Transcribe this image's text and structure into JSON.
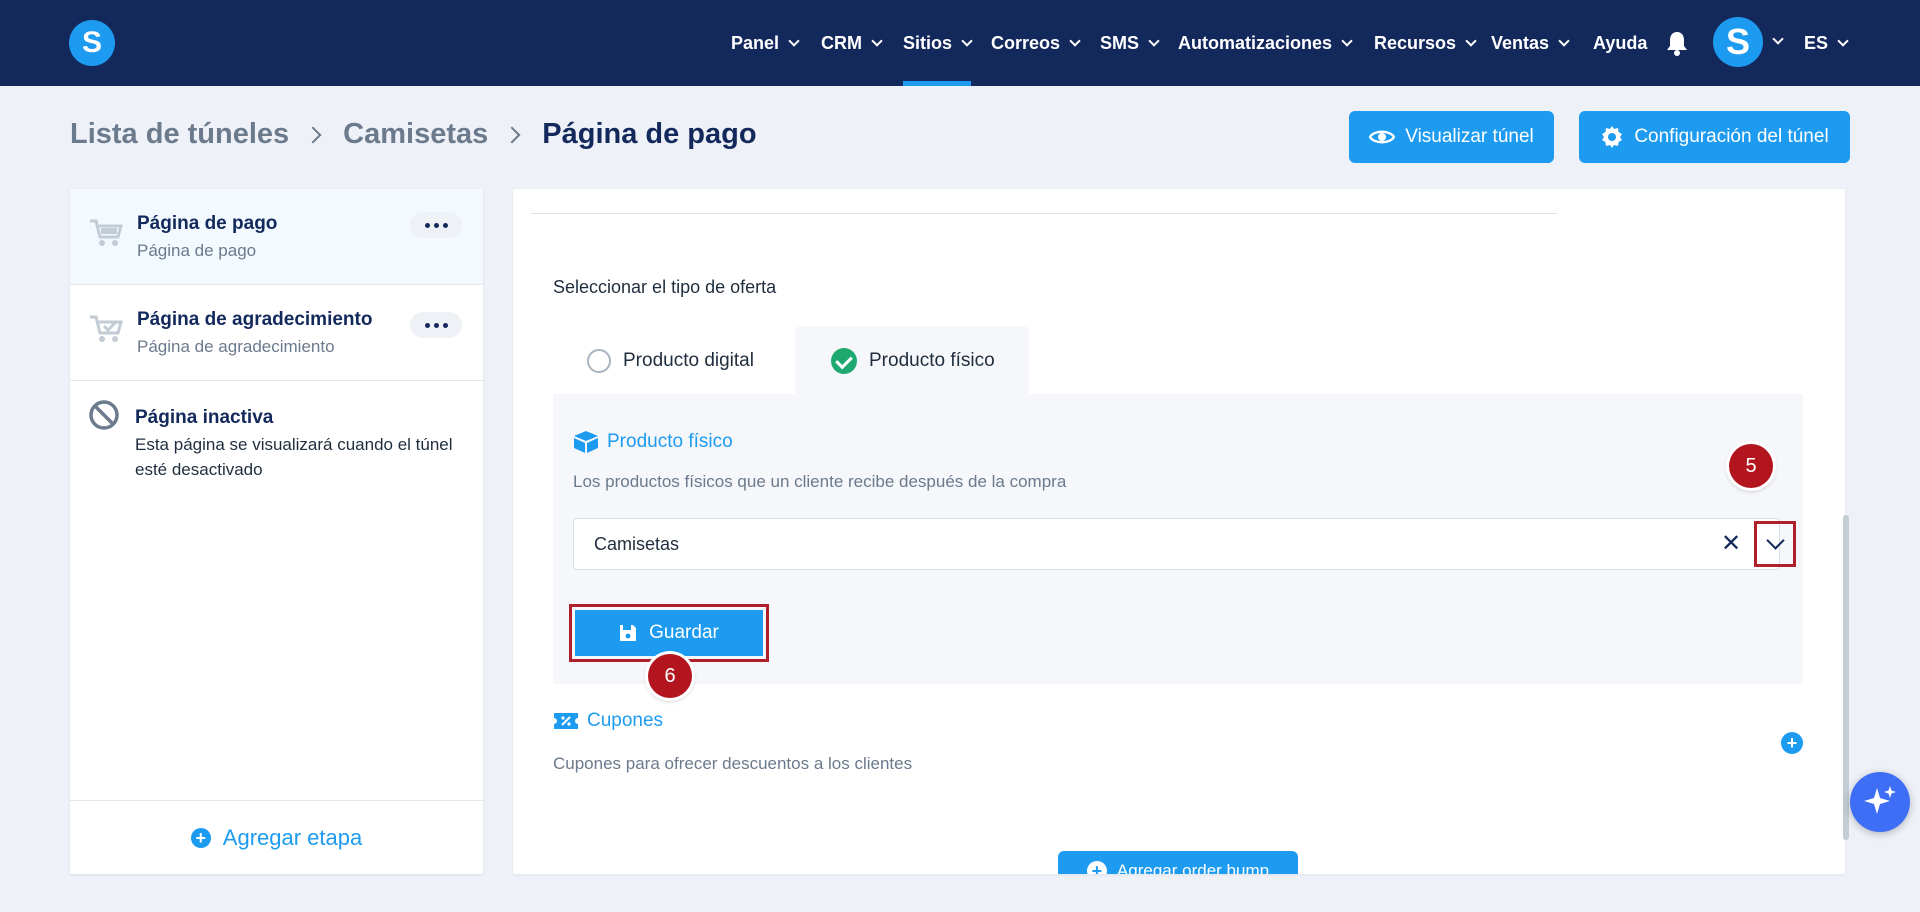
{
  "nav": {
    "logo": "S",
    "items": [
      {
        "label": "Panel"
      },
      {
        "label": "CRM"
      },
      {
        "label": "Sitios"
      },
      {
        "label": "Correos"
      },
      {
        "label": "SMS"
      },
      {
        "label": "Automatizaciones"
      },
      {
        "label": "Recursos"
      },
      {
        "label": "Ventas"
      },
      {
        "label": "Ayuda"
      }
    ],
    "active_item": "Sitios",
    "avatar": "S",
    "language": "ES"
  },
  "breadcrumb": {
    "items": [
      "Lista de túneles",
      "Camisetas"
    ],
    "current": "Página de pago"
  },
  "header_buttons": {
    "view": "Visualizar túnel",
    "config": "Configuración del túnel"
  },
  "steps": [
    {
      "title": "Página de pago",
      "subtitle": "Página de pago"
    },
    {
      "title": "Página de agradecimiento",
      "subtitle": "Página de agradecimiento"
    }
  ],
  "inactive": {
    "title": "Página inactiva",
    "description": "Esta página se visualizará cuando el túnel esté desactivado"
  },
  "add_step": "Agregar etapa",
  "offer": {
    "label": "Seleccionar el tipo de oferta",
    "tabs": [
      "Producto digital",
      "Producto físico"
    ],
    "selected": "Producto físico"
  },
  "physical": {
    "title": "Producto físico",
    "description": "Los productos físicos que un cliente recibe después de la compra",
    "selected_value": "Camisetas",
    "clear_label": "✕",
    "save_label": "Guardar"
  },
  "coupons": {
    "title": "Cupones",
    "description": "Cupones para ofrecer descuentos a los clientes"
  },
  "order_bump": "Agregar order bump",
  "badges": [
    "5",
    "6"
  ],
  "colors": {
    "nav_bg": "#13295c",
    "accent": "#1d9bf0",
    "success": "#1fa971",
    "annotation": "#b0202a"
  }
}
